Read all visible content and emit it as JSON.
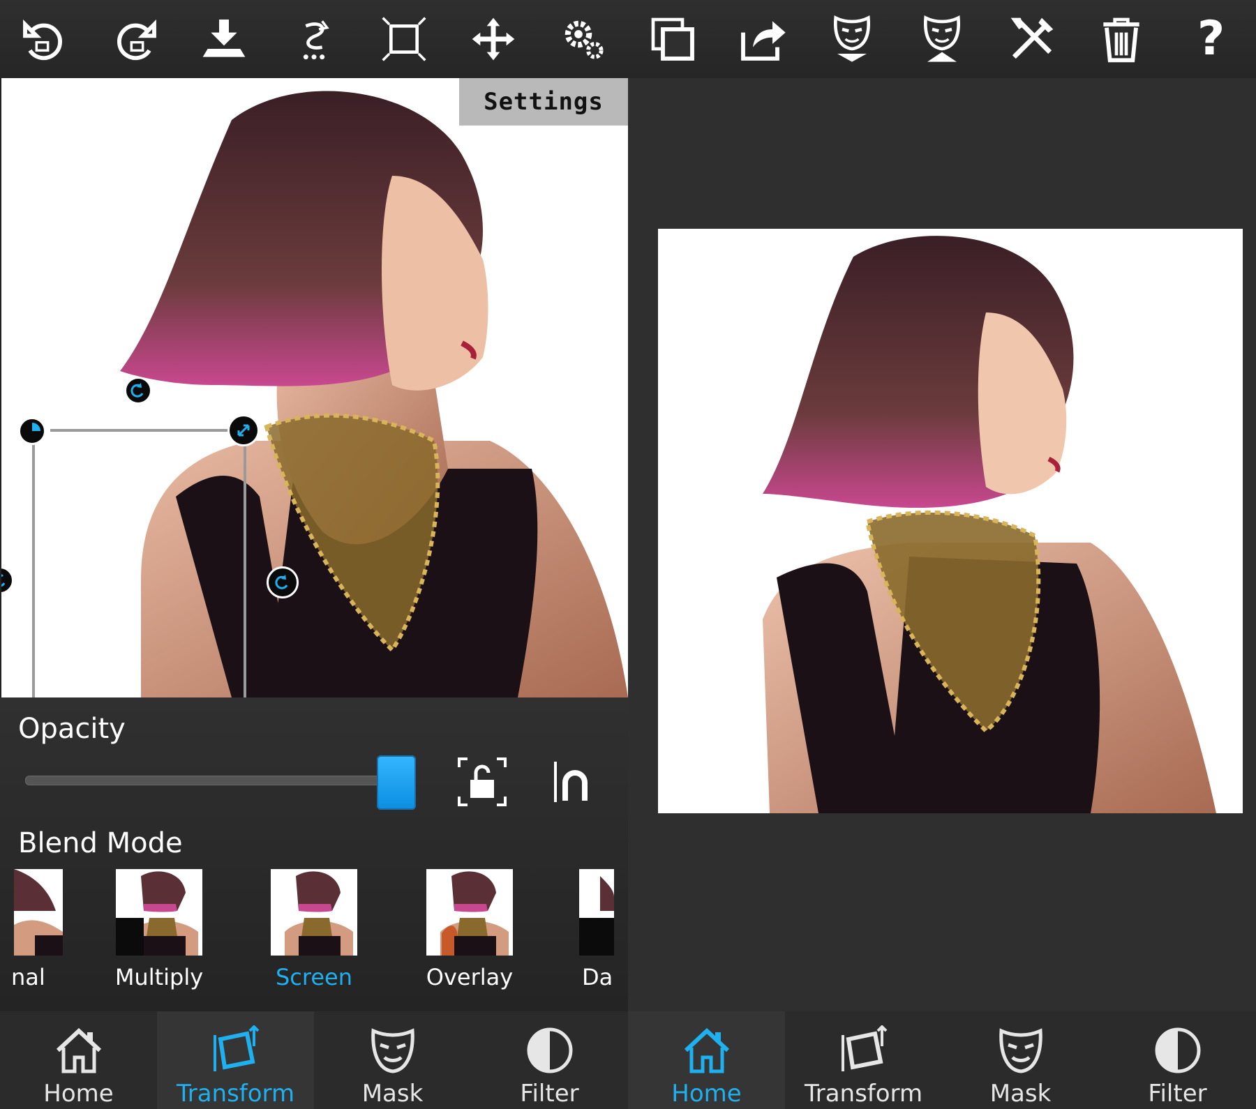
{
  "left": {
    "toolbar": [
      "undo-icon",
      "redo-icon",
      "download-icon",
      "flip-icon",
      "crop-frame-icon",
      "move-icon",
      "gears-icon"
    ],
    "settings_label": "Settings",
    "opacity": {
      "label": "Opacity",
      "value": 1.0
    },
    "blend": {
      "label": "Blend Mode",
      "items": [
        {
          "label": "nal",
          "active": false
        },
        {
          "label": "Multiply",
          "active": false
        },
        {
          "label": "Screen",
          "active": true
        },
        {
          "label": "Overlay",
          "active": false
        },
        {
          "label": "Da",
          "active": false
        }
      ]
    },
    "nav": [
      {
        "label": "Home",
        "icon": "home-icon",
        "active": false
      },
      {
        "label": "Transform",
        "icon": "transform-icon",
        "active": true
      },
      {
        "label": "Mask",
        "icon": "mask-icon",
        "active": false
      },
      {
        "label": "Filter",
        "icon": "filter-icon",
        "active": false
      }
    ]
  },
  "right": {
    "toolbar": [
      "duplicate-icon",
      "share-icon",
      "mask-down-icon",
      "mask-up-icon",
      "tools-icon",
      "trash-icon",
      "help-icon"
    ],
    "help_glyph": "?",
    "nav": [
      {
        "label": "Home",
        "icon": "home-icon",
        "active": true
      },
      {
        "label": "Transform",
        "icon": "transform-icon",
        "active": false
      },
      {
        "label": "Mask",
        "icon": "mask-icon",
        "active": false
      },
      {
        "label": "Filter",
        "icon": "filter-icon",
        "active": false
      }
    ]
  },
  "colors": {
    "accent": "#1fb0f0",
    "toolbar_bg": "#2f2f2f",
    "panel_bg": "#242424"
  }
}
